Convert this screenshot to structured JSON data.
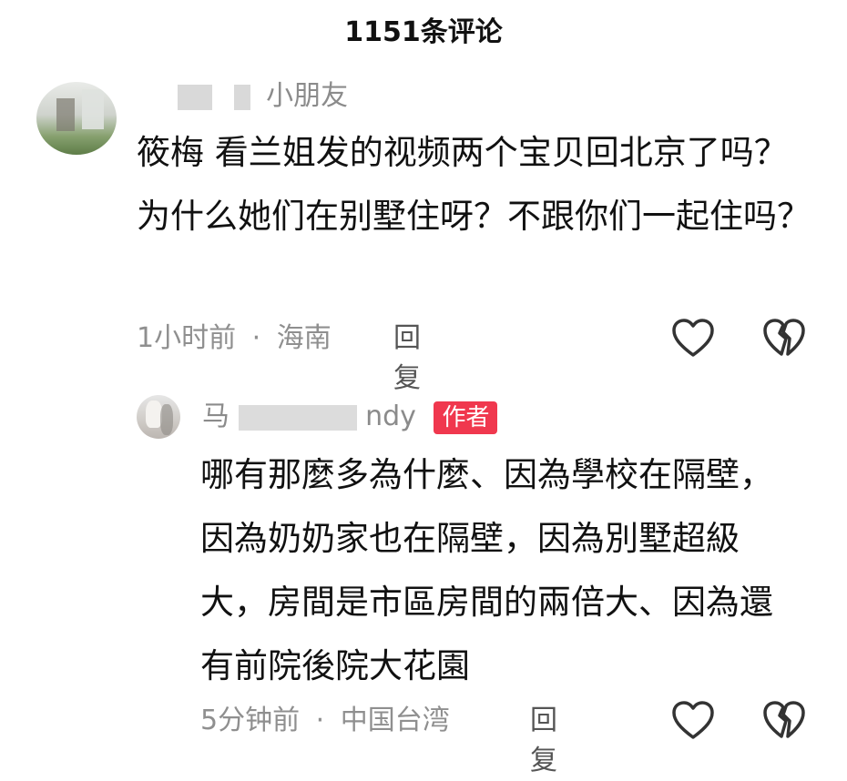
{
  "header": {
    "title": "1151条评论"
  },
  "comments": [
    {
      "username": "小朋友",
      "text": "筱梅 看兰姐发的视频两个宝贝回北京了吗？为什么她们在别墅住呀？不跟你们一起住吗？",
      "time": "1小时前",
      "separator": "·",
      "location": "海南",
      "reply_label": "回复"
    }
  ],
  "replies": [
    {
      "username_prefix": "马",
      "username_suffix": "ndy",
      "author_tag": "作者",
      "text": "哪有那麼多為什麼、因為學校在隔壁，因為奶奶家也在隔壁，因為別墅超級大，房間是市區房間的兩倍大、因為還有前院後院大花園",
      "time": "5分钟前",
      "separator": "·",
      "location": "中国台湾",
      "reply_label": "回复"
    }
  ],
  "icons": {
    "like": "heart-icon",
    "dislike": "broken-heart-icon"
  },
  "colors": {
    "author_tag_bg": "#f0384e",
    "meta_text": "#8f8f8f"
  }
}
